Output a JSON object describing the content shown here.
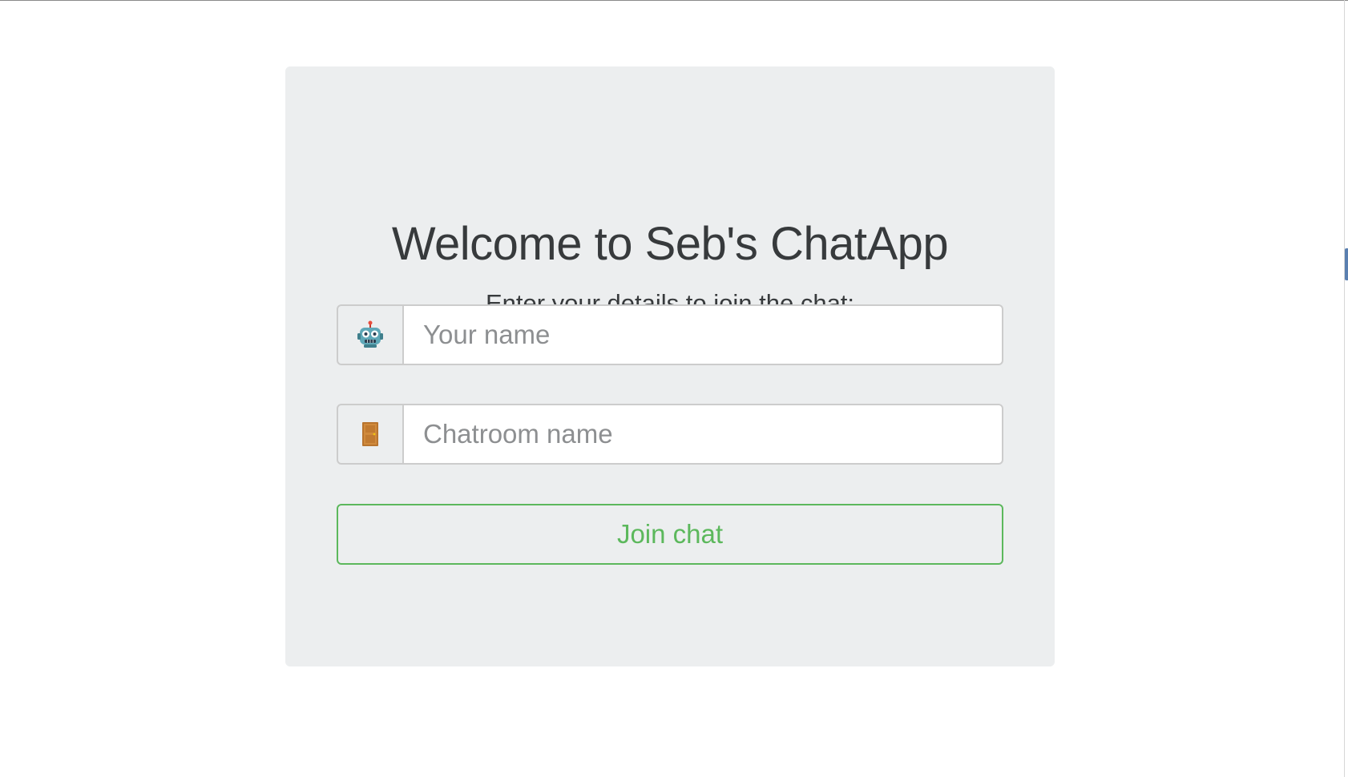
{
  "header": {
    "title": "Welcome to Seb's ChatApp",
    "subtitle": "Enter your details to join the chat:"
  },
  "form": {
    "name_input": {
      "icon": "robot-icon",
      "value": "",
      "placeholder": "Your name"
    },
    "room_input": {
      "icon": "door-icon",
      "value": "",
      "placeholder": "Chatroom name"
    },
    "join_label": "Join chat"
  },
  "colors": {
    "card_background": "#eceeef",
    "heading_text": "#373a3c",
    "success_green": "#5cb85c",
    "input_border": "#cccccc"
  }
}
